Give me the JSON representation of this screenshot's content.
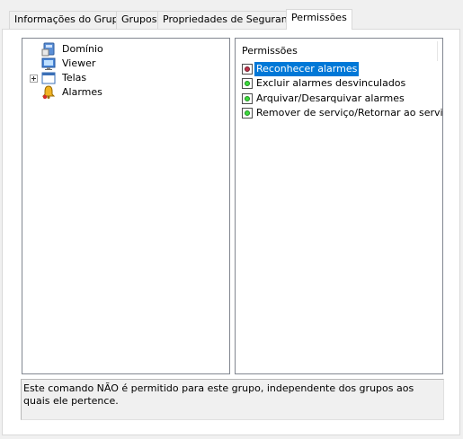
{
  "tabs": [
    {
      "label": "Informações do Grupo",
      "active": false
    },
    {
      "label": "Grupos",
      "active": false
    },
    {
      "label": "Propriedades de Segurança",
      "active": false
    },
    {
      "label": "Permissões",
      "active": true
    }
  ],
  "tree": {
    "items": [
      {
        "label": "Domínio",
        "icon": "domain-icon",
        "expandable": false
      },
      {
        "label": "Viewer",
        "icon": "viewer-icon",
        "expandable": false
      },
      {
        "label": "Telas",
        "icon": "screens-icon",
        "expandable": true
      },
      {
        "label": "Alarmes",
        "icon": "alarms-icon",
        "expandable": false
      }
    ]
  },
  "permissions": {
    "header": "Permissões",
    "items": [
      {
        "label": "Reconhecer alarmes",
        "state": "denied",
        "selected": true
      },
      {
        "label": "Excluir alarmes desvinculados",
        "state": "allowed",
        "selected": false
      },
      {
        "label": "Arquivar/Desarquivar alarmes",
        "state": "allowed",
        "selected": false
      },
      {
        "label": "Remover de serviço/Retornar ao serviço alarmes",
        "state": "allowed",
        "selected": false
      }
    ]
  },
  "description": "Este comando NÃO é permitido para este grupo, independente dos grupos aos quais ele pertence.",
  "colors": {
    "selection": "#0078d7",
    "allowed": "#3ddc3d",
    "denied": "#c0304a"
  }
}
